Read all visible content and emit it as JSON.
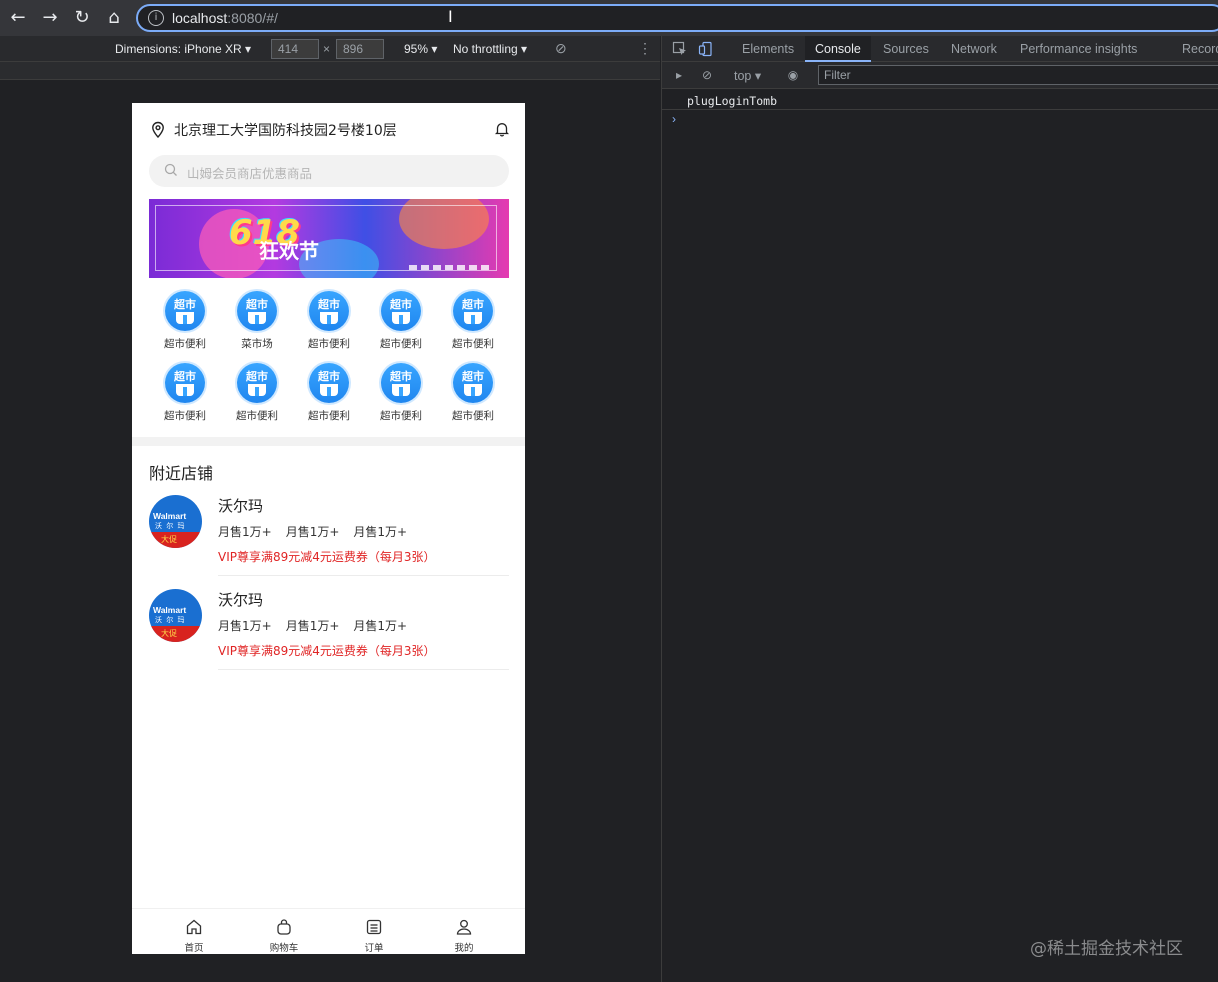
{
  "browser": {
    "url_host": "localhost",
    "url_rest": ":8080/#/"
  },
  "device_toolbar": {
    "dimensions_label": "Dimensions: iPhone XR ▾",
    "width": "414",
    "height": "896",
    "x_label": "×",
    "zoom": "95% ▾",
    "throttle": "No throttling ▾"
  },
  "app": {
    "address": "北京理工大学国防科技园2号楼10层",
    "search_placeholder": "山姆会员商店优惠商品",
    "banner_text": "618",
    "banner_sub": "狂欢节",
    "categories": [
      {
        "icon_text": "超市",
        "label": "超市便利"
      },
      {
        "icon_text": "超市",
        "label": "菜市场"
      },
      {
        "icon_text": "超市",
        "label": "超市便利"
      },
      {
        "icon_text": "超市",
        "label": "超市便利"
      },
      {
        "icon_text": "超市",
        "label": "超市便利"
      },
      {
        "icon_text": "超市",
        "label": "超市便利"
      },
      {
        "icon_text": "超市",
        "label": "超市便利"
      },
      {
        "icon_text": "超市",
        "label": "超市便利"
      },
      {
        "icon_text": "超市",
        "label": "超市便利"
      },
      {
        "icon_text": "超市",
        "label": "超市便利"
      }
    ],
    "nearby_title": "附近店铺",
    "stores": [
      {
        "logo_en": "Walmart",
        "logo_cn": "沃 尔 玛",
        "logo_badge": "大促",
        "name": "沃尔玛",
        "stats": [
          "月售1万+",
          "月售1万+",
          "月售1万+"
        ],
        "promo": "VIP尊享满89元减4元运费券（每月3张）"
      },
      {
        "logo_en": "Walmart",
        "logo_cn": "沃 尔 玛",
        "logo_badge": "大促",
        "name": "沃尔玛",
        "stats": [
          "月售1万+",
          "月售1万+",
          "月售1万+"
        ],
        "promo": "VIP尊享满89元减4元运费券（每月3张）"
      }
    ],
    "tabbar": [
      {
        "label": "首页",
        "icon": "home-icon"
      },
      {
        "label": "购物车",
        "icon": "cart-icon"
      },
      {
        "label": "订单",
        "icon": "order-icon"
      },
      {
        "label": "我的",
        "icon": "user-icon"
      }
    ]
  },
  "devtools": {
    "tabs": [
      "Elements",
      "Console",
      "Sources",
      "Network",
      "Performance insights",
      "Recorder"
    ],
    "active_tab": "Console",
    "context": "top ▾",
    "filter_placeholder": "Filter",
    "console_output": "plugLoginTomb",
    "prompt": "›"
  },
  "watermark": "@稀土掘金技术社区",
  "colors": {
    "accent": "#7cacf8",
    "promo_red": "#e02424",
    "category_blue": "#1f86ef"
  }
}
